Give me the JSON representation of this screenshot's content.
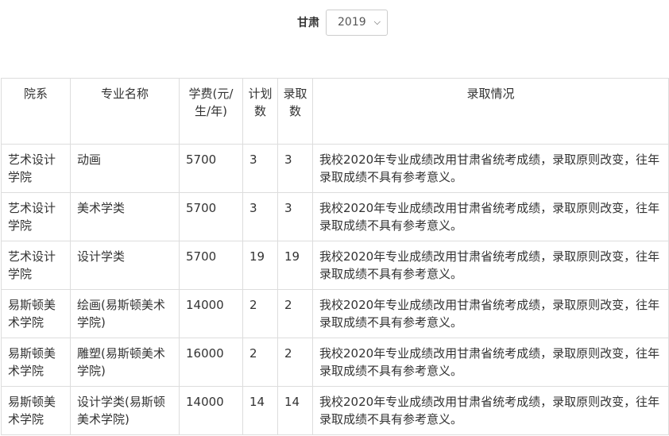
{
  "filter": {
    "province_label": "甘肃",
    "year_selected": "2019"
  },
  "table": {
    "headers": {
      "college": "院系",
      "major": "专业名称",
      "fee": "学费(元/生/年)",
      "plan": "计划数",
      "admitted": "录取数",
      "status": "录取情况"
    },
    "rows": [
      {
        "college": "艺术设计学院",
        "major": "动画",
        "fee": "5700",
        "plan": "3",
        "admitted": "3",
        "status": "我校2020年专业成绩改用甘肃省统考成绩，录取原则改变，往年录取成绩不具有参考意义。"
      },
      {
        "college": "艺术设计学院",
        "major": "美术学类",
        "fee": "5700",
        "plan": "3",
        "admitted": "3",
        "status": "我校2020年专业成绩改用甘肃省统考成绩，录取原则改变，往年录取成绩不具有参考意义。"
      },
      {
        "college": "艺术设计学院",
        "major": "设计学类",
        "fee": "5700",
        "plan": "19",
        "admitted": "19",
        "status": "我校2020年专业成绩改用甘肃省统考成绩，录取原则改变，往年录取成绩不具有参考意义。"
      },
      {
        "college": "易斯顿美术学院",
        "major": "绘画(易斯顿美术学院)",
        "fee": "14000",
        "plan": "2",
        "admitted": "2",
        "status": "我校2020年专业成绩改用甘肃省统考成绩，录取原则改变，往年录取成绩不具有参考意义。"
      },
      {
        "college": "易斯顿美术学院",
        "major": "雕塑(易斯顿美术学院)",
        "fee": "16000",
        "plan": "2",
        "admitted": "2",
        "status": "我校2020年专业成绩改用甘肃省统考成绩，录取原则改变，往年录取成绩不具有参考意义。"
      },
      {
        "college": "易斯顿美术学院",
        "major": "设计学类(易斯顿美术学院)",
        "fee": "14000",
        "plan": "14",
        "admitted": "14",
        "status": "我校2020年专业成绩改用甘肃省统考成绩，录取原则改变，往年录取成绩不具有参考意义。"
      }
    ]
  }
}
